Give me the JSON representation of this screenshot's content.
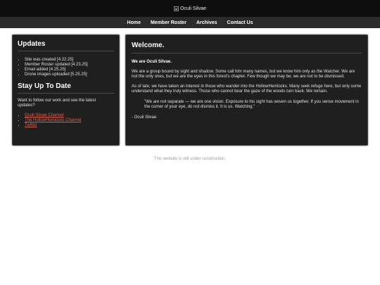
{
  "header": {
    "logo_alt": "Oculi Silvae"
  },
  "nav": {
    "items": [
      "Home",
      "Member Roster",
      "Archives",
      "Contact Us"
    ]
  },
  "updates": {
    "title": "Updates",
    "items": [
      "Site was created [4.22.25]",
      "Member Roster updated [4.23.25]",
      "Email added [4.25.25]",
      "Drone images uploaded [5.25.25]"
    ]
  },
  "stay": {
    "title": "Stay Up To Date",
    "text": "Want to follow our work and see the latest updates?",
    "links": [
      "Oculi Silvae Channel",
      "The HollowHemlocks Channel",
      "Twitter"
    ]
  },
  "welcome": {
    "title": "Welcome.",
    "intro": "We are Oculi Silvae.",
    "p1": "We are a group bound by sight and shadow. Some call him many names, but we know him only as the Watcher. We are not the only ones, but we are the eyes in this forest's chapter. Few though we may be, we are not to be dismissed.",
    "p2": "As of late, we have taken an interest in those who wander into the HollowHemlocks. Many seek refuge here, but only some understand what they truly witness. Those who cannot bear the gaze of the woods turn back. We remain.",
    "quote": "\"We are not separate — we are one vision. Exposure to his sight has woven us together. If you sense movement in the corner of your eye, do not dismiss it. It is us. Watching.\"",
    "signature": "- Oculi Silvae"
  },
  "footer": {
    "text": "This website is still under construction."
  },
  "colors": {
    "header_bg": "#0e0e0e",
    "nav_bg": "#2b2b2b",
    "panel_bg": "#1f1f1f",
    "link": "#e0614c"
  }
}
